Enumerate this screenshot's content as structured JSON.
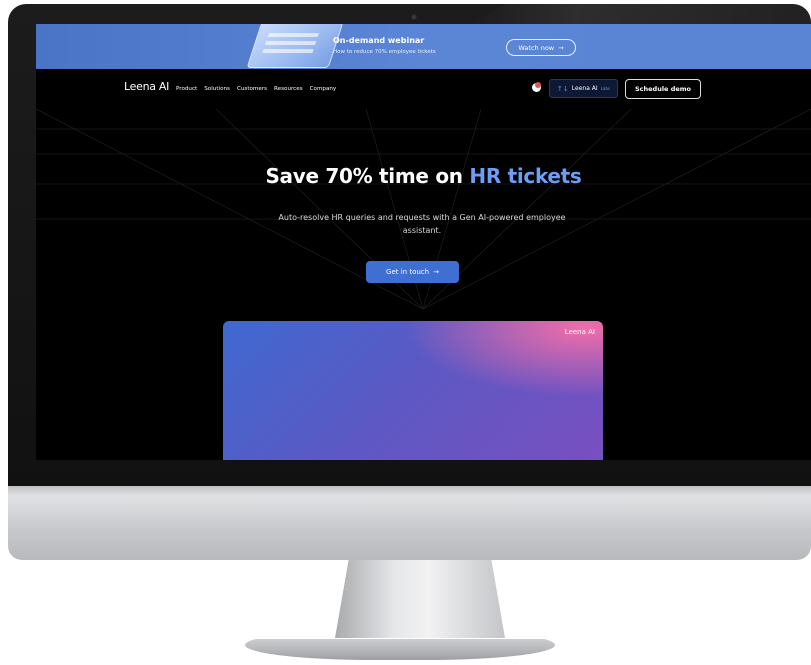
{
  "promo": {
    "title": "On-demand webinar",
    "subtitle": "How to reduce 70% employee tickets",
    "button_label": "Watch now",
    "button_arrow": "→"
  },
  "nav": {
    "logo": "Leena AI",
    "links": [
      "Product",
      "Solutions",
      "Customers",
      "Resources",
      "Company"
    ],
    "labs_label": "Leena AI",
    "labs_tag": "Labs",
    "labs_icon": "↑↓",
    "demo_label": "Schedule demo"
  },
  "hero": {
    "title_prefix": "Save 70% time on ",
    "title_accent": "HR tickets",
    "subtitle": "Auto-resolve HR queries and requests with a Gen AI-powered employee assistant.",
    "cta_label": "Get in touch",
    "cta_arrow": "→"
  },
  "video": {
    "logo": "Leena AI"
  },
  "colors": {
    "promo_bg": "#5b86d6",
    "accent": "#6f9cf5",
    "cta_bg": "#3f6fd2",
    "page_bg": "#000000"
  }
}
